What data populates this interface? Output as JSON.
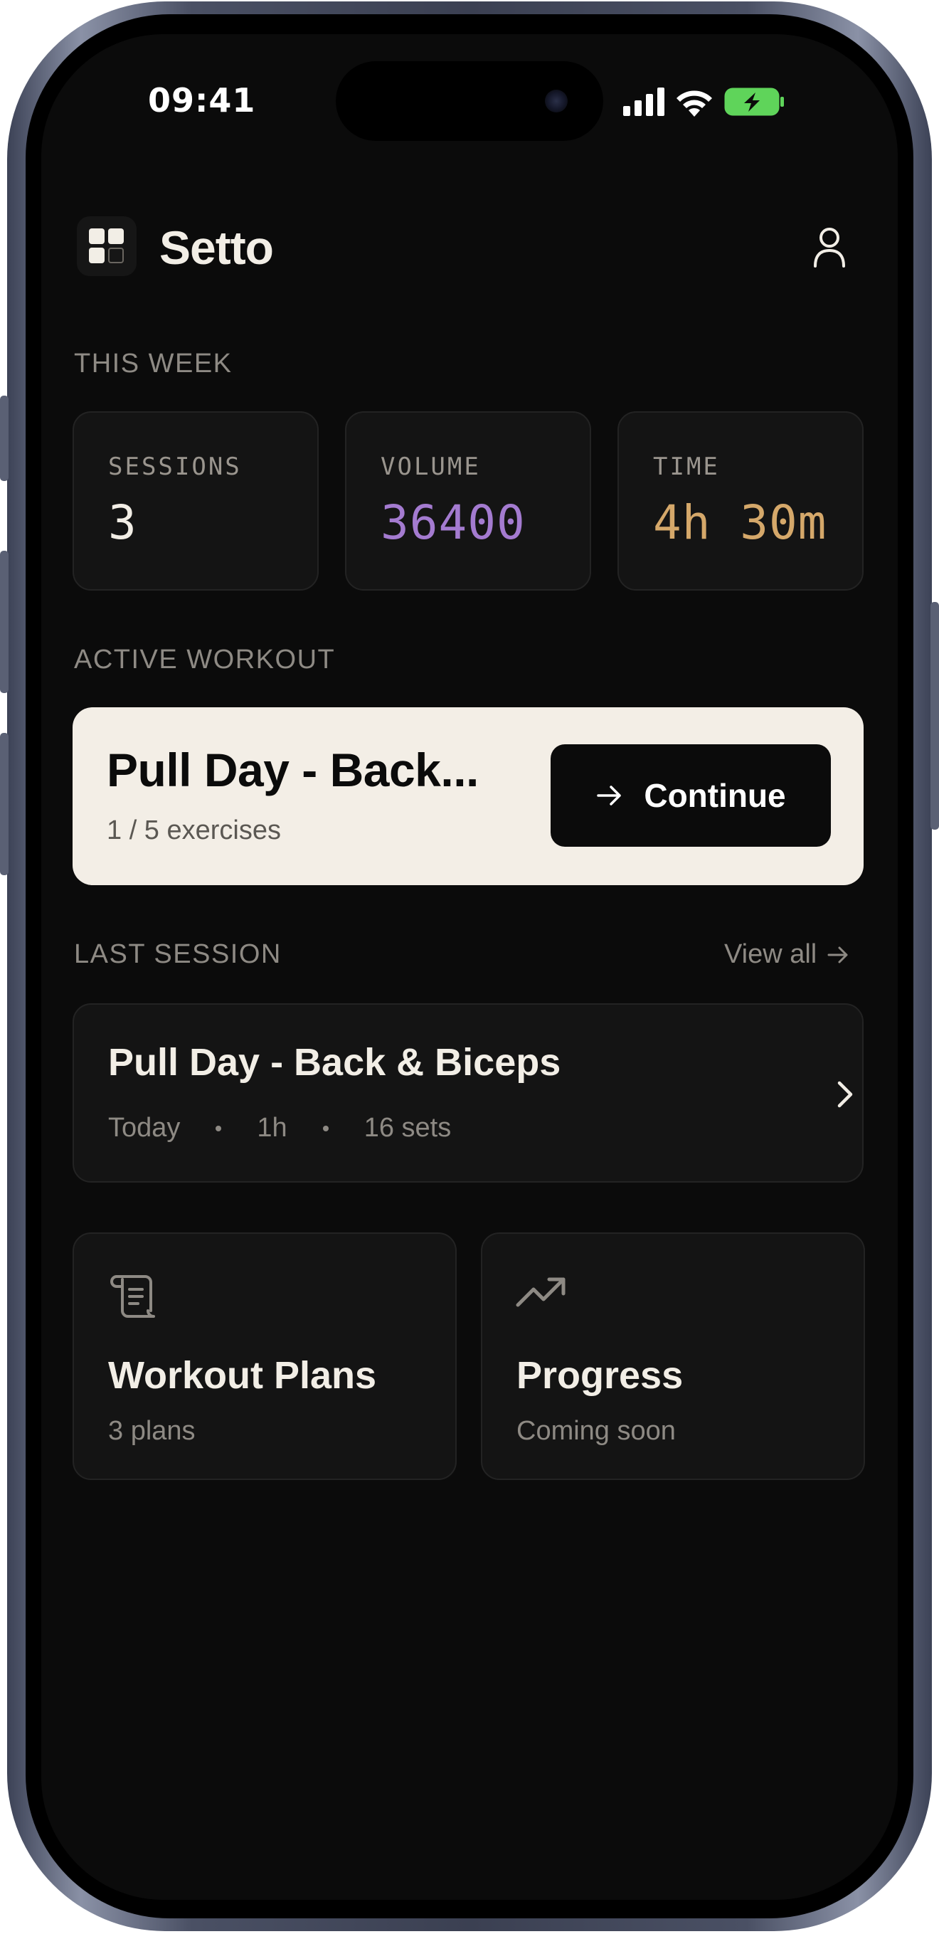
{
  "status_bar": {
    "time": "09:41"
  },
  "header": {
    "app_name": "Setto",
    "logo_icon": "grid-logo-icon",
    "profile_icon": "user-icon"
  },
  "this_week": {
    "label": "THIS WEEK",
    "stats": [
      {
        "label": "SESSIONS",
        "value": "3",
        "color": "#f2eee6"
      },
      {
        "label": "VOLUME",
        "value": "36400",
        "color": "#a47bd0"
      },
      {
        "label": "TIME",
        "value": "4h 30m",
        "color": "#d5a86a"
      }
    ]
  },
  "active_workout": {
    "label": "ACTIVE WORKOUT",
    "title": "Pull Day - Back...",
    "subtitle": "1 / 5 exercises",
    "continue_label": "Continue"
  },
  "last_session": {
    "label": "LAST SESSION",
    "view_all_label": "View all",
    "title": "Pull Day - Back & Biceps",
    "meta": [
      "Today",
      "1h",
      "16 sets"
    ]
  },
  "tiles": [
    {
      "title": "Workout Plans",
      "subtitle": "3 plans",
      "icon": "scroll-icon"
    },
    {
      "title": "Progress",
      "subtitle": "Coming soon",
      "icon": "trending-up-icon"
    }
  ],
  "colors": {
    "background": "#0b0b0b",
    "card": "#141414",
    "accent_purple": "#a47bd0",
    "accent_gold": "#d5a86a",
    "cream": "#f3eee6",
    "battery_green": "#5fd45a"
  }
}
